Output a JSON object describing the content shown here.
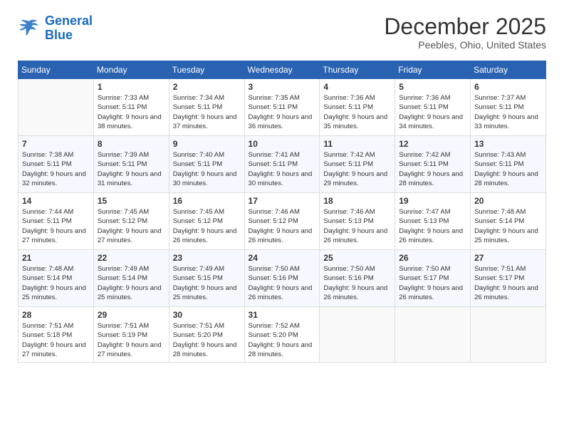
{
  "logo": {
    "line1": "General",
    "line2": "Blue"
  },
  "title": "December 2025",
  "location": "Peebles, Ohio, United States",
  "days_header": [
    "Sunday",
    "Monday",
    "Tuesday",
    "Wednesday",
    "Thursday",
    "Friday",
    "Saturday"
  ],
  "weeks": [
    [
      {
        "day": "",
        "sunrise": "",
        "sunset": "",
        "daylight": ""
      },
      {
        "day": "1",
        "sunrise": "Sunrise: 7:33 AM",
        "sunset": "Sunset: 5:11 PM",
        "daylight": "Daylight: 9 hours and 38 minutes."
      },
      {
        "day": "2",
        "sunrise": "Sunrise: 7:34 AM",
        "sunset": "Sunset: 5:11 PM",
        "daylight": "Daylight: 9 hours and 37 minutes."
      },
      {
        "day": "3",
        "sunrise": "Sunrise: 7:35 AM",
        "sunset": "Sunset: 5:11 PM",
        "daylight": "Daylight: 9 hours and 36 minutes."
      },
      {
        "day": "4",
        "sunrise": "Sunrise: 7:36 AM",
        "sunset": "Sunset: 5:11 PM",
        "daylight": "Daylight: 9 hours and 35 minutes."
      },
      {
        "day": "5",
        "sunrise": "Sunrise: 7:36 AM",
        "sunset": "Sunset: 5:11 PM",
        "daylight": "Daylight: 9 hours and 34 minutes."
      },
      {
        "day": "6",
        "sunrise": "Sunrise: 7:37 AM",
        "sunset": "Sunset: 5:11 PM",
        "daylight": "Daylight: 9 hours and 33 minutes."
      }
    ],
    [
      {
        "day": "7",
        "sunrise": "Sunrise: 7:38 AM",
        "sunset": "Sunset: 5:11 PM",
        "daylight": "Daylight: 9 hours and 32 minutes."
      },
      {
        "day": "8",
        "sunrise": "Sunrise: 7:39 AM",
        "sunset": "Sunset: 5:11 PM",
        "daylight": "Daylight: 9 hours and 31 minutes."
      },
      {
        "day": "9",
        "sunrise": "Sunrise: 7:40 AM",
        "sunset": "Sunset: 5:11 PM",
        "daylight": "Daylight: 9 hours and 30 minutes."
      },
      {
        "day": "10",
        "sunrise": "Sunrise: 7:41 AM",
        "sunset": "Sunset: 5:11 PM",
        "daylight": "Daylight: 9 hours and 30 minutes."
      },
      {
        "day": "11",
        "sunrise": "Sunrise: 7:42 AM",
        "sunset": "Sunset: 5:11 PM",
        "daylight": "Daylight: 9 hours and 29 minutes."
      },
      {
        "day": "12",
        "sunrise": "Sunrise: 7:42 AM",
        "sunset": "Sunset: 5:11 PM",
        "daylight": "Daylight: 9 hours and 28 minutes."
      },
      {
        "day": "13",
        "sunrise": "Sunrise: 7:43 AM",
        "sunset": "Sunset: 5:11 PM",
        "daylight": "Daylight: 9 hours and 28 minutes."
      }
    ],
    [
      {
        "day": "14",
        "sunrise": "Sunrise: 7:44 AM",
        "sunset": "Sunset: 5:11 PM",
        "daylight": "Daylight: 9 hours and 27 minutes."
      },
      {
        "day": "15",
        "sunrise": "Sunrise: 7:45 AM",
        "sunset": "Sunset: 5:12 PM",
        "daylight": "Daylight: 9 hours and 27 minutes."
      },
      {
        "day": "16",
        "sunrise": "Sunrise: 7:45 AM",
        "sunset": "Sunset: 5:12 PM",
        "daylight": "Daylight: 9 hours and 26 minutes."
      },
      {
        "day": "17",
        "sunrise": "Sunrise: 7:46 AM",
        "sunset": "Sunset: 5:12 PM",
        "daylight": "Daylight: 9 hours and 26 minutes."
      },
      {
        "day": "18",
        "sunrise": "Sunrise: 7:46 AM",
        "sunset": "Sunset: 5:13 PM",
        "daylight": "Daylight: 9 hours and 26 minutes."
      },
      {
        "day": "19",
        "sunrise": "Sunrise: 7:47 AM",
        "sunset": "Sunset: 5:13 PM",
        "daylight": "Daylight: 9 hours and 26 minutes."
      },
      {
        "day": "20",
        "sunrise": "Sunrise: 7:48 AM",
        "sunset": "Sunset: 5:14 PM",
        "daylight": "Daylight: 9 hours and 25 minutes."
      }
    ],
    [
      {
        "day": "21",
        "sunrise": "Sunrise: 7:48 AM",
        "sunset": "Sunset: 5:14 PM",
        "daylight": "Daylight: 9 hours and 25 minutes."
      },
      {
        "day": "22",
        "sunrise": "Sunrise: 7:49 AM",
        "sunset": "Sunset: 5:14 PM",
        "daylight": "Daylight: 9 hours and 25 minutes."
      },
      {
        "day": "23",
        "sunrise": "Sunrise: 7:49 AM",
        "sunset": "Sunset: 5:15 PM",
        "daylight": "Daylight: 9 hours and 25 minutes."
      },
      {
        "day": "24",
        "sunrise": "Sunrise: 7:50 AM",
        "sunset": "Sunset: 5:16 PM",
        "daylight": "Daylight: 9 hours and 26 minutes."
      },
      {
        "day": "25",
        "sunrise": "Sunrise: 7:50 AM",
        "sunset": "Sunset: 5:16 PM",
        "daylight": "Daylight: 9 hours and 26 minutes."
      },
      {
        "day": "26",
        "sunrise": "Sunrise: 7:50 AM",
        "sunset": "Sunset: 5:17 PM",
        "daylight": "Daylight: 9 hours and 26 minutes."
      },
      {
        "day": "27",
        "sunrise": "Sunrise: 7:51 AM",
        "sunset": "Sunset: 5:17 PM",
        "daylight": "Daylight: 9 hours and 26 minutes."
      }
    ],
    [
      {
        "day": "28",
        "sunrise": "Sunrise: 7:51 AM",
        "sunset": "Sunset: 5:18 PM",
        "daylight": "Daylight: 9 hours and 27 minutes."
      },
      {
        "day": "29",
        "sunrise": "Sunrise: 7:51 AM",
        "sunset": "Sunset: 5:19 PM",
        "daylight": "Daylight: 9 hours and 27 minutes."
      },
      {
        "day": "30",
        "sunrise": "Sunrise: 7:51 AM",
        "sunset": "Sunset: 5:20 PM",
        "daylight": "Daylight: 9 hours and 28 minutes."
      },
      {
        "day": "31",
        "sunrise": "Sunrise: 7:52 AM",
        "sunset": "Sunset: 5:20 PM",
        "daylight": "Daylight: 9 hours and 28 minutes."
      },
      {
        "day": "",
        "sunrise": "",
        "sunset": "",
        "daylight": ""
      },
      {
        "day": "",
        "sunrise": "",
        "sunset": "",
        "daylight": ""
      },
      {
        "day": "",
        "sunrise": "",
        "sunset": "",
        "daylight": ""
      }
    ]
  ]
}
